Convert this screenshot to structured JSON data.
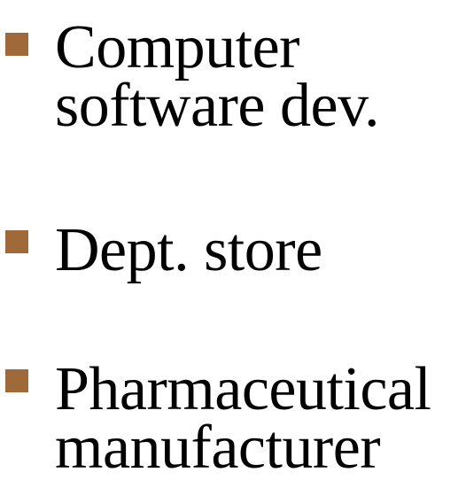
{
  "bullets": [
    {
      "lines": [
        "Computer",
        "software dev."
      ]
    },
    {
      "lines": [
        "Dept. store"
      ]
    },
    {
      "lines": [
        "Pharmaceutical",
        "manufacturer"
      ]
    }
  ],
  "colors": {
    "bullet_marker": "#a0693a",
    "text": "#000000",
    "background": "#ffffff"
  },
  "icons": {
    "bullet_marker": "square-bullet-icon"
  }
}
